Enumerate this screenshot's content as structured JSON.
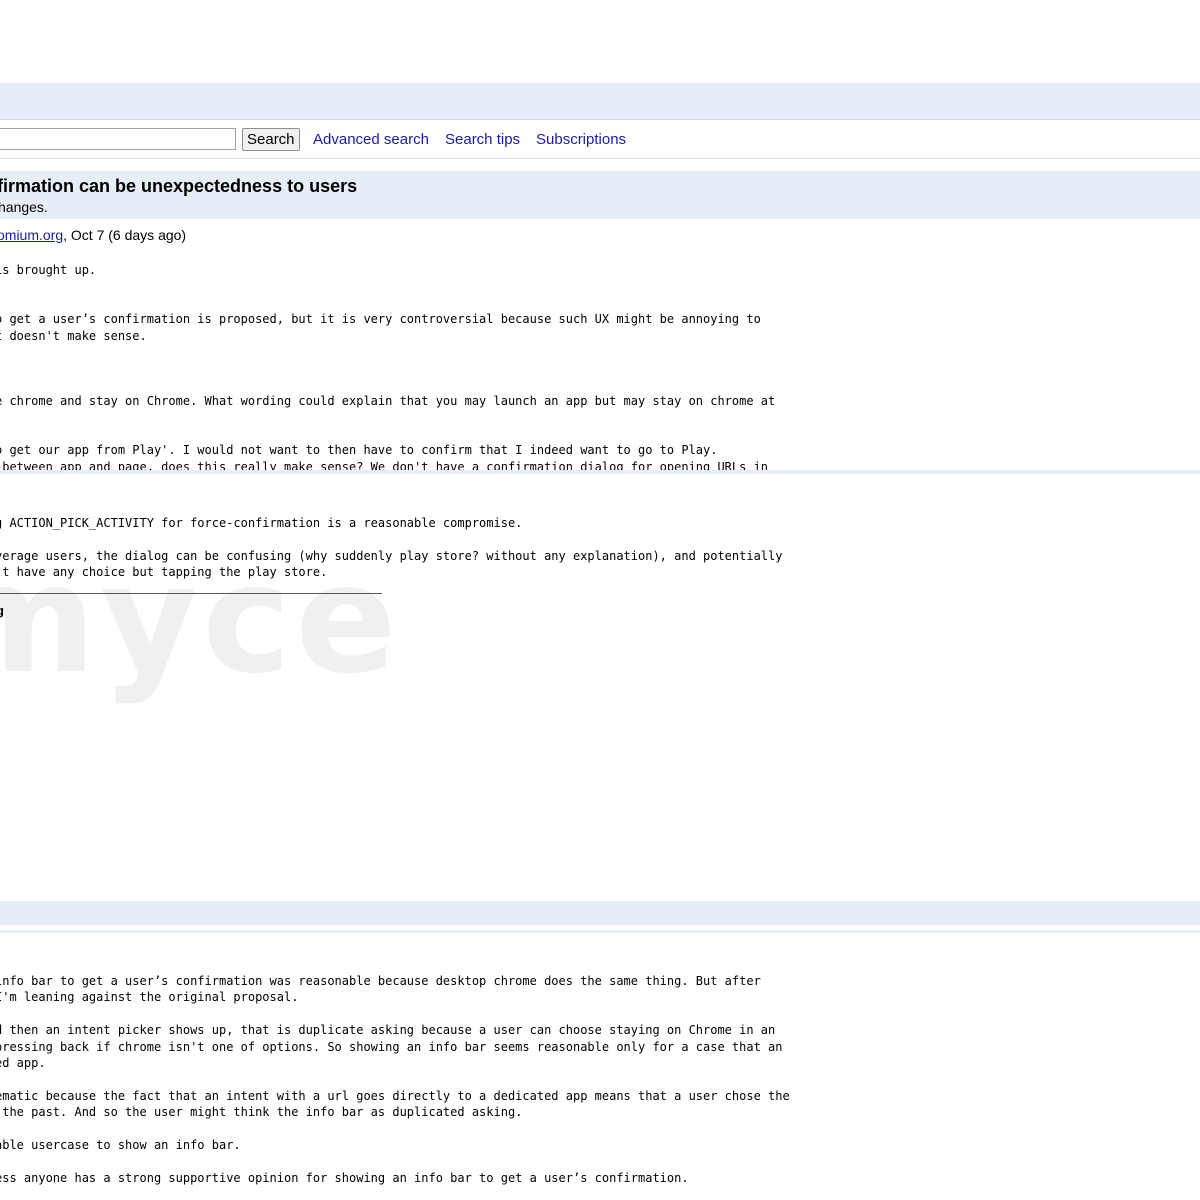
{
  "search": {
    "input_value": "",
    "button_label": "Search",
    "links": {
      "advanced": "Advanced search",
      "tips": "Search tips",
      "subscriptions": "Subscriptions"
    }
  },
  "issue": {
    "title": "firmation can be unexpectedness to users",
    "subtitle": "hanges."
  },
  "comment1": {
    "author_link": "omium.org",
    "date_text": ", Oct 7 (6 days ago)",
    "body": "is brought up.\n\n\no get a user’s confirmation is proposed, but it is very controversial because such UX might be annoying to\nt doesn't make sense.\n\n\n\ne chrome and stay on Chrome. What wording could explain that you may launch an app but may stay on chrome at\n\n\no get our app from Play'. I would not want to then have to confirm that I indeed want to go to Play.\n between app and page, does this really make sense? We don't have a confirmation dialog for opening URLs in"
  },
  "comment2": {
    "body": "g ACTION_PICK_ACTIVITY for force-confirmation is a reasonable compromise.\n\nverage users, the dialog can be confusing (why suddenly play store? without any explanation), and potentially\n't have any choice but tapping the play store.",
    "signature": "g"
  },
  "watermark": "myce",
  "comment3": {
    "body": "info bar to get a user’s confirmation was reasonable because desktop chrome does the same thing. But after\nI'm leaning against the original proposal.\n\nd then an intent picker shows up, that is duplicate asking because a user can choose staying on Chrome in an\npressing back if chrome isn't one of options. So showing an info bar seems reasonable only for a case that an\ned app.\n\nematic because the fact that an intent with a url goes directly to a dedicated app means that a user chose the\n the past. And so the user might think the info bar as duplicated asking.\n\nable usercase to show an info bar.\n\ness anyone has a strong supportive opinion for showing an info bar to get a user’s confirmation."
  }
}
